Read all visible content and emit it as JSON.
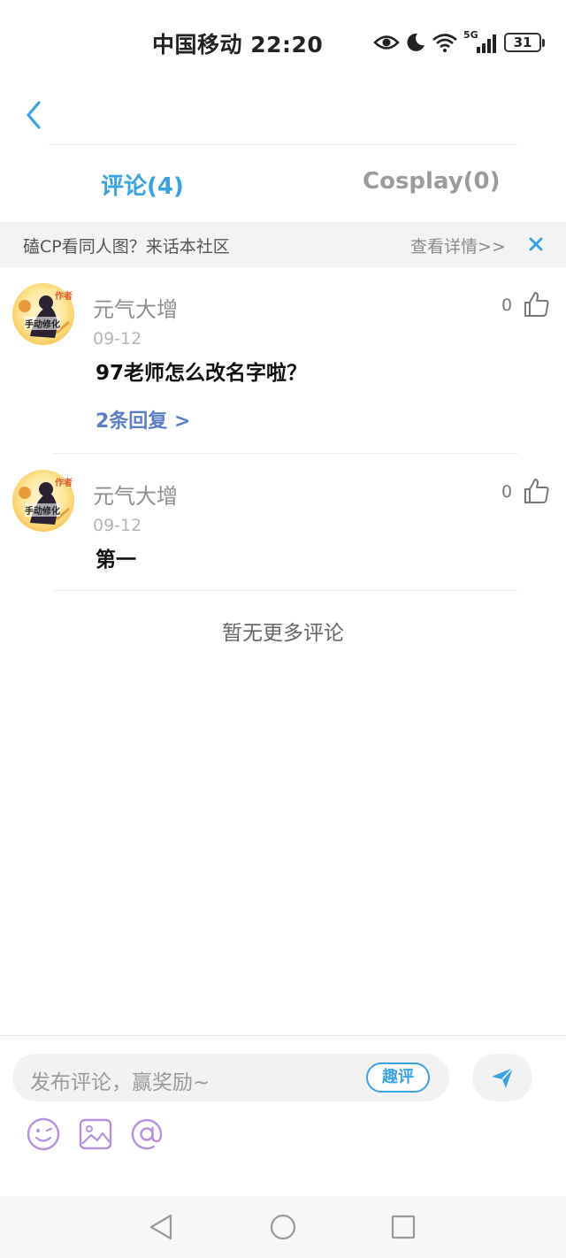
{
  "status_bar": {
    "carrier_time": "中国移动 22:20",
    "network_label": "5G",
    "battery": "31"
  },
  "tabs": [
    {
      "label": "评论(4)",
      "active": true
    },
    {
      "label": "Cosplay(0)",
      "active": false
    }
  ],
  "banner": {
    "text": "磕CP看同人图？来话本社区",
    "link": "查看详情>>"
  },
  "comments": [
    {
      "author": "元气大增",
      "likes": "0",
      "date": "09-12",
      "content": "97老师怎么改名字啦？",
      "replies": "2条回复 >",
      "avatar_badge": "作者",
      "avatar_text": "手动修化"
    },
    {
      "author": "元气大增",
      "likes": "0",
      "date": "09-12",
      "content": "第一",
      "avatar_badge": "作者",
      "avatar_text": "手动修化"
    }
  ],
  "no_more_text": "暂无更多评论",
  "input": {
    "placeholder": "发布评论，赢奖励~",
    "quping_label": "趣评"
  },
  "colors": {
    "accent": "#3aa2e0",
    "reply_link": "#5b7fc7",
    "tool_icon": "#b78fe0"
  },
  "icons": [
    "back-arrow-icon",
    "close-icon",
    "thumbs-up-icon",
    "send-icon",
    "emoji-icon",
    "image-icon",
    "at-icon",
    "eye-icon",
    "moon-icon",
    "wifi-icon",
    "signal-icon",
    "battery-icon"
  ]
}
